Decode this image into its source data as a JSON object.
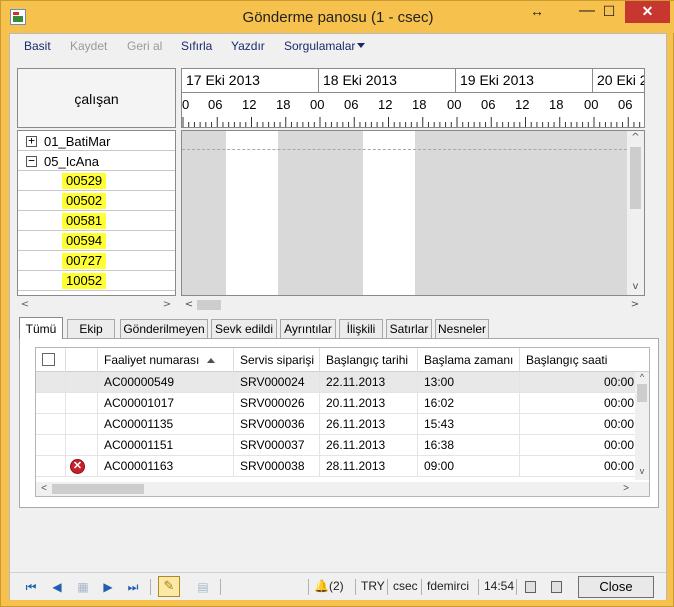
{
  "window": {
    "title": "Gönderme panosu (1 - csec)",
    "resize_glyph": "↔",
    "minimize_glyph": "—",
    "maximize_glyph": "☐",
    "close_glyph": "✕"
  },
  "menu": {
    "items": [
      {
        "label": "Basit",
        "enabled": true
      },
      {
        "label": "Kaydet",
        "enabled": false
      },
      {
        "label": "Geri al",
        "enabled": false
      },
      {
        "label": "Sıfırla",
        "enabled": true
      },
      {
        "label": "Yazdır",
        "enabled": true
      },
      {
        "label": "Sorgulamalar",
        "enabled": true,
        "has_dropdown": true
      }
    ]
  },
  "gantt": {
    "employee_header": "çalışan",
    "groups": [
      {
        "label": "01_BatiMar",
        "expander": "+"
      },
      {
        "label": "05_IcAna",
        "expander": "−"
      }
    ],
    "employees": [
      "00529",
      "00502",
      "00581",
      "00594",
      "00727",
      "10052"
    ],
    "employee_highlight_color": "#ffff33",
    "dates": [
      "17 Eki 2013",
      "18 Eki 2013",
      "19 Eki 2013",
      "20 Eki 2"
    ],
    "hours": [
      "0",
      "06",
      "12",
      "18",
      "00",
      "06",
      "12",
      "18",
      "00",
      "06",
      "12",
      "18",
      "00",
      "06"
    ]
  },
  "tabs": [
    {
      "label": "Tümü",
      "active": true
    },
    {
      "label": "Ekip",
      "active": false
    },
    {
      "label": "Gönderilmeyen",
      "active": false
    },
    {
      "label": "Sevk edildi",
      "active": false
    },
    {
      "label": "Ayrıntılar",
      "active": false
    },
    {
      "label": "İlişkili",
      "active": false
    },
    {
      "label": "Satırlar",
      "active": false
    },
    {
      "label": "Nesneler",
      "active": false
    }
  ],
  "grid": {
    "columns": [
      "Faaliyet numarası",
      "Servis siparişi",
      "Başlangıç tarihi",
      "Başlama zamanı",
      "Başlangıç saati"
    ],
    "rows": [
      {
        "activity": "AC00000549",
        "order": "SRV000024",
        "start_date": "22.11.2013",
        "start_time": "13:00",
        "start_hour": "00:00",
        "selected": true,
        "error": false
      },
      {
        "activity": "AC00001017",
        "order": "SRV000026",
        "start_date": "20.11.2013",
        "start_time": "16:02",
        "start_hour": "00:00",
        "selected": false,
        "error": false
      },
      {
        "activity": "AC00001135",
        "order": "SRV000036",
        "start_date": "26.11.2013",
        "start_time": "15:43",
        "start_hour": "00:00",
        "selected": false,
        "error": false
      },
      {
        "activity": "AC00001151",
        "order": "SRV000037",
        "start_date": "26.11.2013",
        "start_time": "16:38",
        "start_hour": "00:00",
        "selected": false,
        "error": false
      },
      {
        "activity": "AC00001163",
        "order": "SRV000038",
        "start_date": "28.11.2013",
        "start_time": "09:00",
        "start_hour": "00:00",
        "selected": false,
        "error": true
      }
    ]
  },
  "statusbar": {
    "notifications": "(2)",
    "currency": "TRY",
    "company": "csec",
    "user": "fdemirci",
    "time": "14:54",
    "close_label": "Close"
  },
  "colors": {
    "title_bar": "#f6c14c",
    "close_red": "#c7372f",
    "menu_text": "#1b2a6b",
    "nav_blue": "#1f5fb0"
  }
}
